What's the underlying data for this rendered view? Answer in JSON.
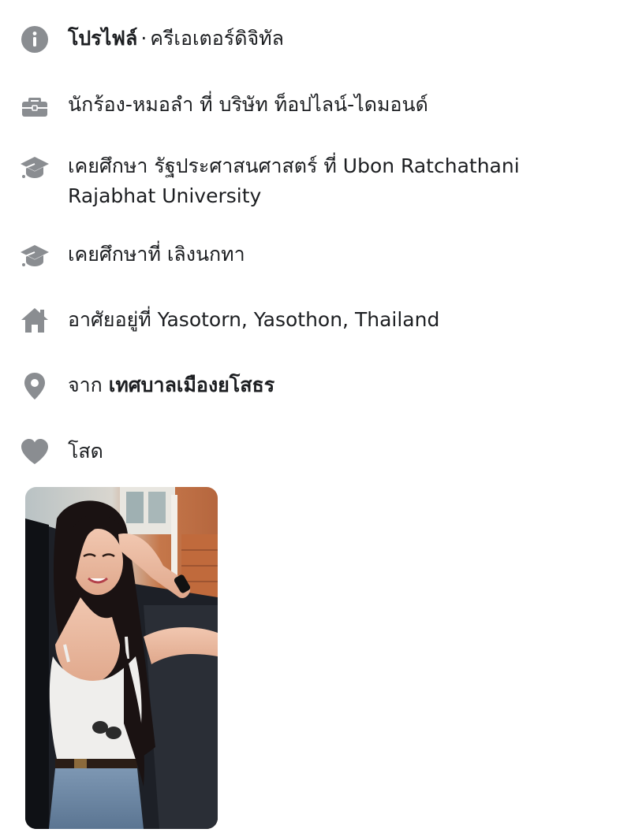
{
  "intro": {
    "profile": {
      "icon": "info-icon",
      "label": "โปรไฟล์",
      "separator": "·",
      "category": "ครีเอเตอร์ดิจิทัล"
    },
    "work": {
      "icon": "briefcase-icon",
      "text": "นักร้อง-หมอลำ ที่ บริษัท ท็อปไลน์-ไดมอนด์"
    },
    "education_1": {
      "icon": "graduation-cap-icon",
      "text": "เคยศึกษา รัฐประศาสนศาสตร์ ที่ Ubon Ratchathani Rajabhat University"
    },
    "education_2": {
      "icon": "graduation-cap-icon",
      "text": "เคยศึกษาที่ เลิงนกทา"
    },
    "lives_in": {
      "icon": "home-icon",
      "text": "อาศัยอยู่ที่ Yasotorn, Yasothon, Thailand"
    },
    "from": {
      "icon": "location-pin-icon",
      "prefix": "จาก",
      "place": "เทศบาลเมืองยโสธร"
    },
    "relationship": {
      "icon": "heart-icon",
      "text": "โสด"
    }
  },
  "featured_photo": {
    "type": "photo"
  },
  "colors": {
    "icon_gray": "#8a8d91",
    "text": "#1c1e21"
  }
}
